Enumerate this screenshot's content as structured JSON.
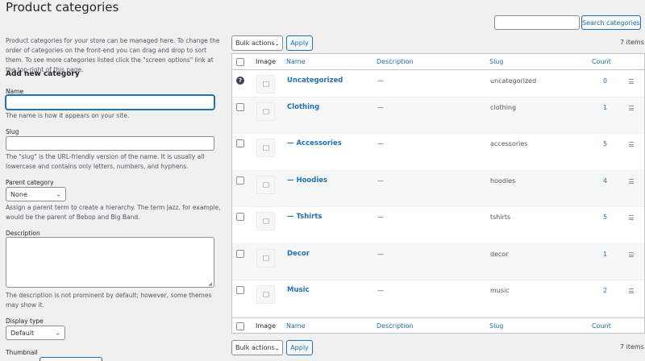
{
  "page": {
    "title": "Product categories"
  },
  "search": {
    "button_label": "Search categories",
    "value": ""
  },
  "intro": "Product categories for your store can be managed here. To change the order of categories on the front-end you can drag and drop to sort them. To see more categories listed click the \"screen options\" link at the top-right of this page.",
  "form": {
    "heading": "Add new category",
    "name_label": "Name",
    "name_help": "The name is how it appears on your site.",
    "slug_label": "Slug",
    "slug_help": "The \"slug\" is the URL-friendly version of the name. It is usually all lowercase and contains only letters, numbers, and hyphens.",
    "parent_label": "Parent category",
    "parent_value": "None",
    "parent_help": "Assign a parent term to create a hierarchy. The term Jazz, for example, would be the parent of Bebop and Big Band.",
    "description_label": "Description",
    "description_help": "The description is not prominent by default; however, some themes may show it.",
    "display_type_label": "Display type",
    "display_type_value": "Default",
    "thumbnail_label": "Thumbnail"
  },
  "bulk": {
    "label": "Bulk actions",
    "apply": "Apply",
    "items_count": "7 items"
  },
  "columns": {
    "image": "Image",
    "name": "Name",
    "description": "Description",
    "slug": "Slug",
    "count": "Count"
  },
  "rows": [
    {
      "name": "Uncategorized",
      "description": "—",
      "slug": "uncategorized",
      "count": "0"
    },
    {
      "name": "Clothing",
      "description": "—",
      "slug": "clothing",
      "count": "1"
    },
    {
      "name": "— Accessories",
      "description": "—",
      "slug": "accessories",
      "count": "5"
    },
    {
      "name": "— Hoodies",
      "description": "—",
      "slug": "hoodies",
      "count": "4"
    },
    {
      "name": "— Tshirts",
      "description": "—",
      "slug": "tshirts",
      "count": "5"
    },
    {
      "name": "Decor",
      "description": "—",
      "slug": "decor",
      "count": "1"
    },
    {
      "name": "Music",
      "description": "—",
      "slug": "music",
      "count": "2"
    }
  ],
  "colors": {
    "link": "#2271b1",
    "background": "#f0f0f1"
  }
}
